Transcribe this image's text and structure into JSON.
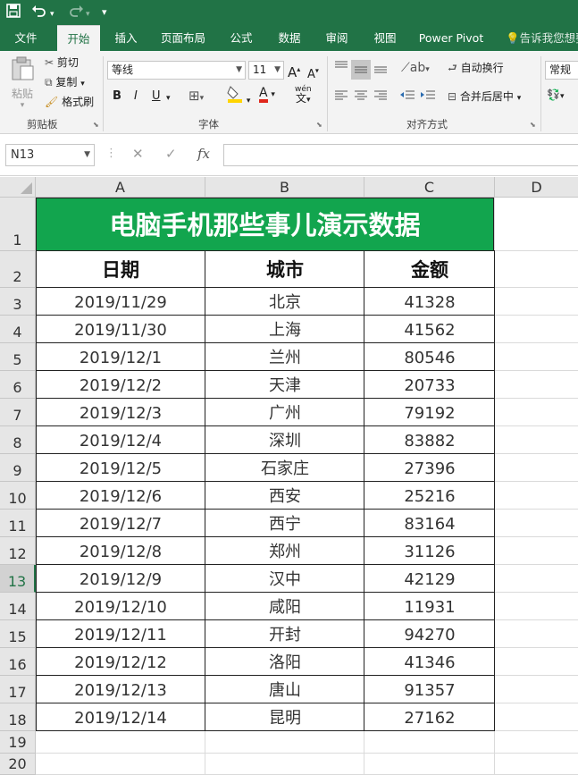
{
  "quick_access": {
    "save_icon": "save-icon",
    "undo_icon": "undo-icon",
    "redo_icon": "redo-icon",
    "customize_icon": "customize-icon"
  },
  "tabs": [
    "文件",
    "开始",
    "插入",
    "页面布局",
    "公式",
    "数据",
    "审阅",
    "视图",
    "Power Pivot"
  ],
  "active_tab": "开始",
  "tell_me": "告诉我您想要",
  "ribbon": {
    "paste_label": "粘贴",
    "cut_label": "剪切",
    "copy_label": "复制",
    "format_painter_label": "格式刷",
    "clipboard_group": "剪贴板",
    "font_name": "等线",
    "font_size": "11",
    "font_group": "字体",
    "bold": "B",
    "italic": "I",
    "underline": "U",
    "phonetic": "wén",
    "wrap_text_label": "自动换行",
    "merge_center_label": "合并后居中",
    "alignment_group": "对齐方式",
    "number_format": "常规"
  },
  "formula_bar": {
    "name_box": "N13",
    "cancel": "✕",
    "enter": "✓",
    "fx": "fx",
    "formula": ""
  },
  "columns": [
    "A",
    "B",
    "C",
    "D"
  ],
  "rows": [
    "1",
    "2",
    "3",
    "4",
    "5",
    "6",
    "7",
    "8",
    "9",
    "10",
    "11",
    "12",
    "13",
    "14",
    "15",
    "16",
    "17",
    "18",
    "19",
    "20"
  ],
  "selected_row": "13",
  "sheet": {
    "title": "电脑手机那些事儿演示数据",
    "headers": [
      "日期",
      "城市",
      "金额"
    ],
    "records": [
      [
        "2019/11/29",
        "北京",
        "41328"
      ],
      [
        "2019/11/30",
        "上海",
        "41562"
      ],
      [
        "2019/12/1",
        "兰州",
        "80546"
      ],
      [
        "2019/12/2",
        "天津",
        "20733"
      ],
      [
        "2019/12/3",
        "广州",
        "79192"
      ],
      [
        "2019/12/4",
        "深圳",
        "83882"
      ],
      [
        "2019/12/5",
        "石家庄",
        "27396"
      ],
      [
        "2019/12/6",
        "西安",
        "25216"
      ],
      [
        "2019/12/7",
        "西宁",
        "83164"
      ],
      [
        "2019/12/8",
        "郑州",
        "31126"
      ],
      [
        "2019/12/9",
        "汉中",
        "42129"
      ],
      [
        "2019/12/10",
        "咸阳",
        "11931"
      ],
      [
        "2019/12/11",
        "开封",
        "94270"
      ],
      [
        "2019/12/12",
        "洛阳",
        "41346"
      ],
      [
        "2019/12/13",
        "唐山",
        "91357"
      ],
      [
        "2019/12/14",
        "昆明",
        "27162"
      ]
    ]
  },
  "colors": {
    "excel_green": "#217346",
    "title_fill": "#12a54e"
  }
}
